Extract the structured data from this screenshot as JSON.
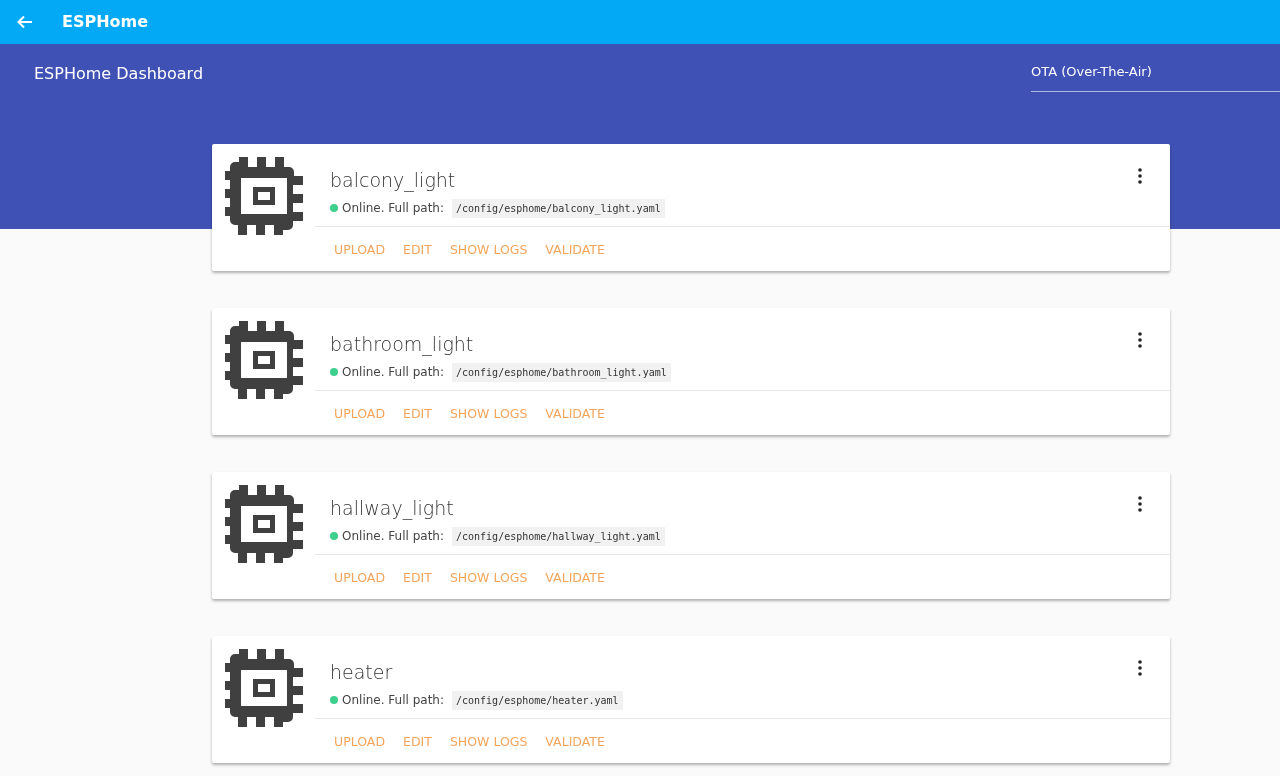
{
  "app_bar": {
    "title": "ESPHome"
  },
  "header": {
    "title": "ESPHome Dashboard",
    "upload_mode": {
      "value": "OTA (Over-The-Air)"
    }
  },
  "devices": [
    {
      "name": "balcony_light",
      "status": "Online. Full path:",
      "color": "#3ecf8e",
      "path": "/config/esphome/balcony_light.yaml",
      "actions": [
        "UPLOAD",
        "EDIT",
        "SHOW LOGS",
        "VALIDATE"
      ]
    },
    {
      "name": "bathroom_light",
      "status": "Online. Full path:",
      "color": "#3ecf8e",
      "path": "/config/esphome/bathroom_light.yaml",
      "actions": [
        "UPLOAD",
        "EDIT",
        "SHOW LOGS",
        "VALIDATE"
      ]
    },
    {
      "name": "hallway_light",
      "status": "Online. Full path:",
      "color": "#3ecf8e",
      "path": "/config/esphome/hallway_light.yaml",
      "actions": [
        "UPLOAD",
        "EDIT",
        "SHOW LOGS",
        "VALIDATE"
      ]
    },
    {
      "name": "heater",
      "status": "Online. Full path:",
      "color": "#3ecf8e",
      "path": "/config/esphome/heater.yaml",
      "actions": [
        "UPLOAD",
        "EDIT",
        "SHOW LOGS",
        "VALIDATE"
      ]
    }
  ]
}
